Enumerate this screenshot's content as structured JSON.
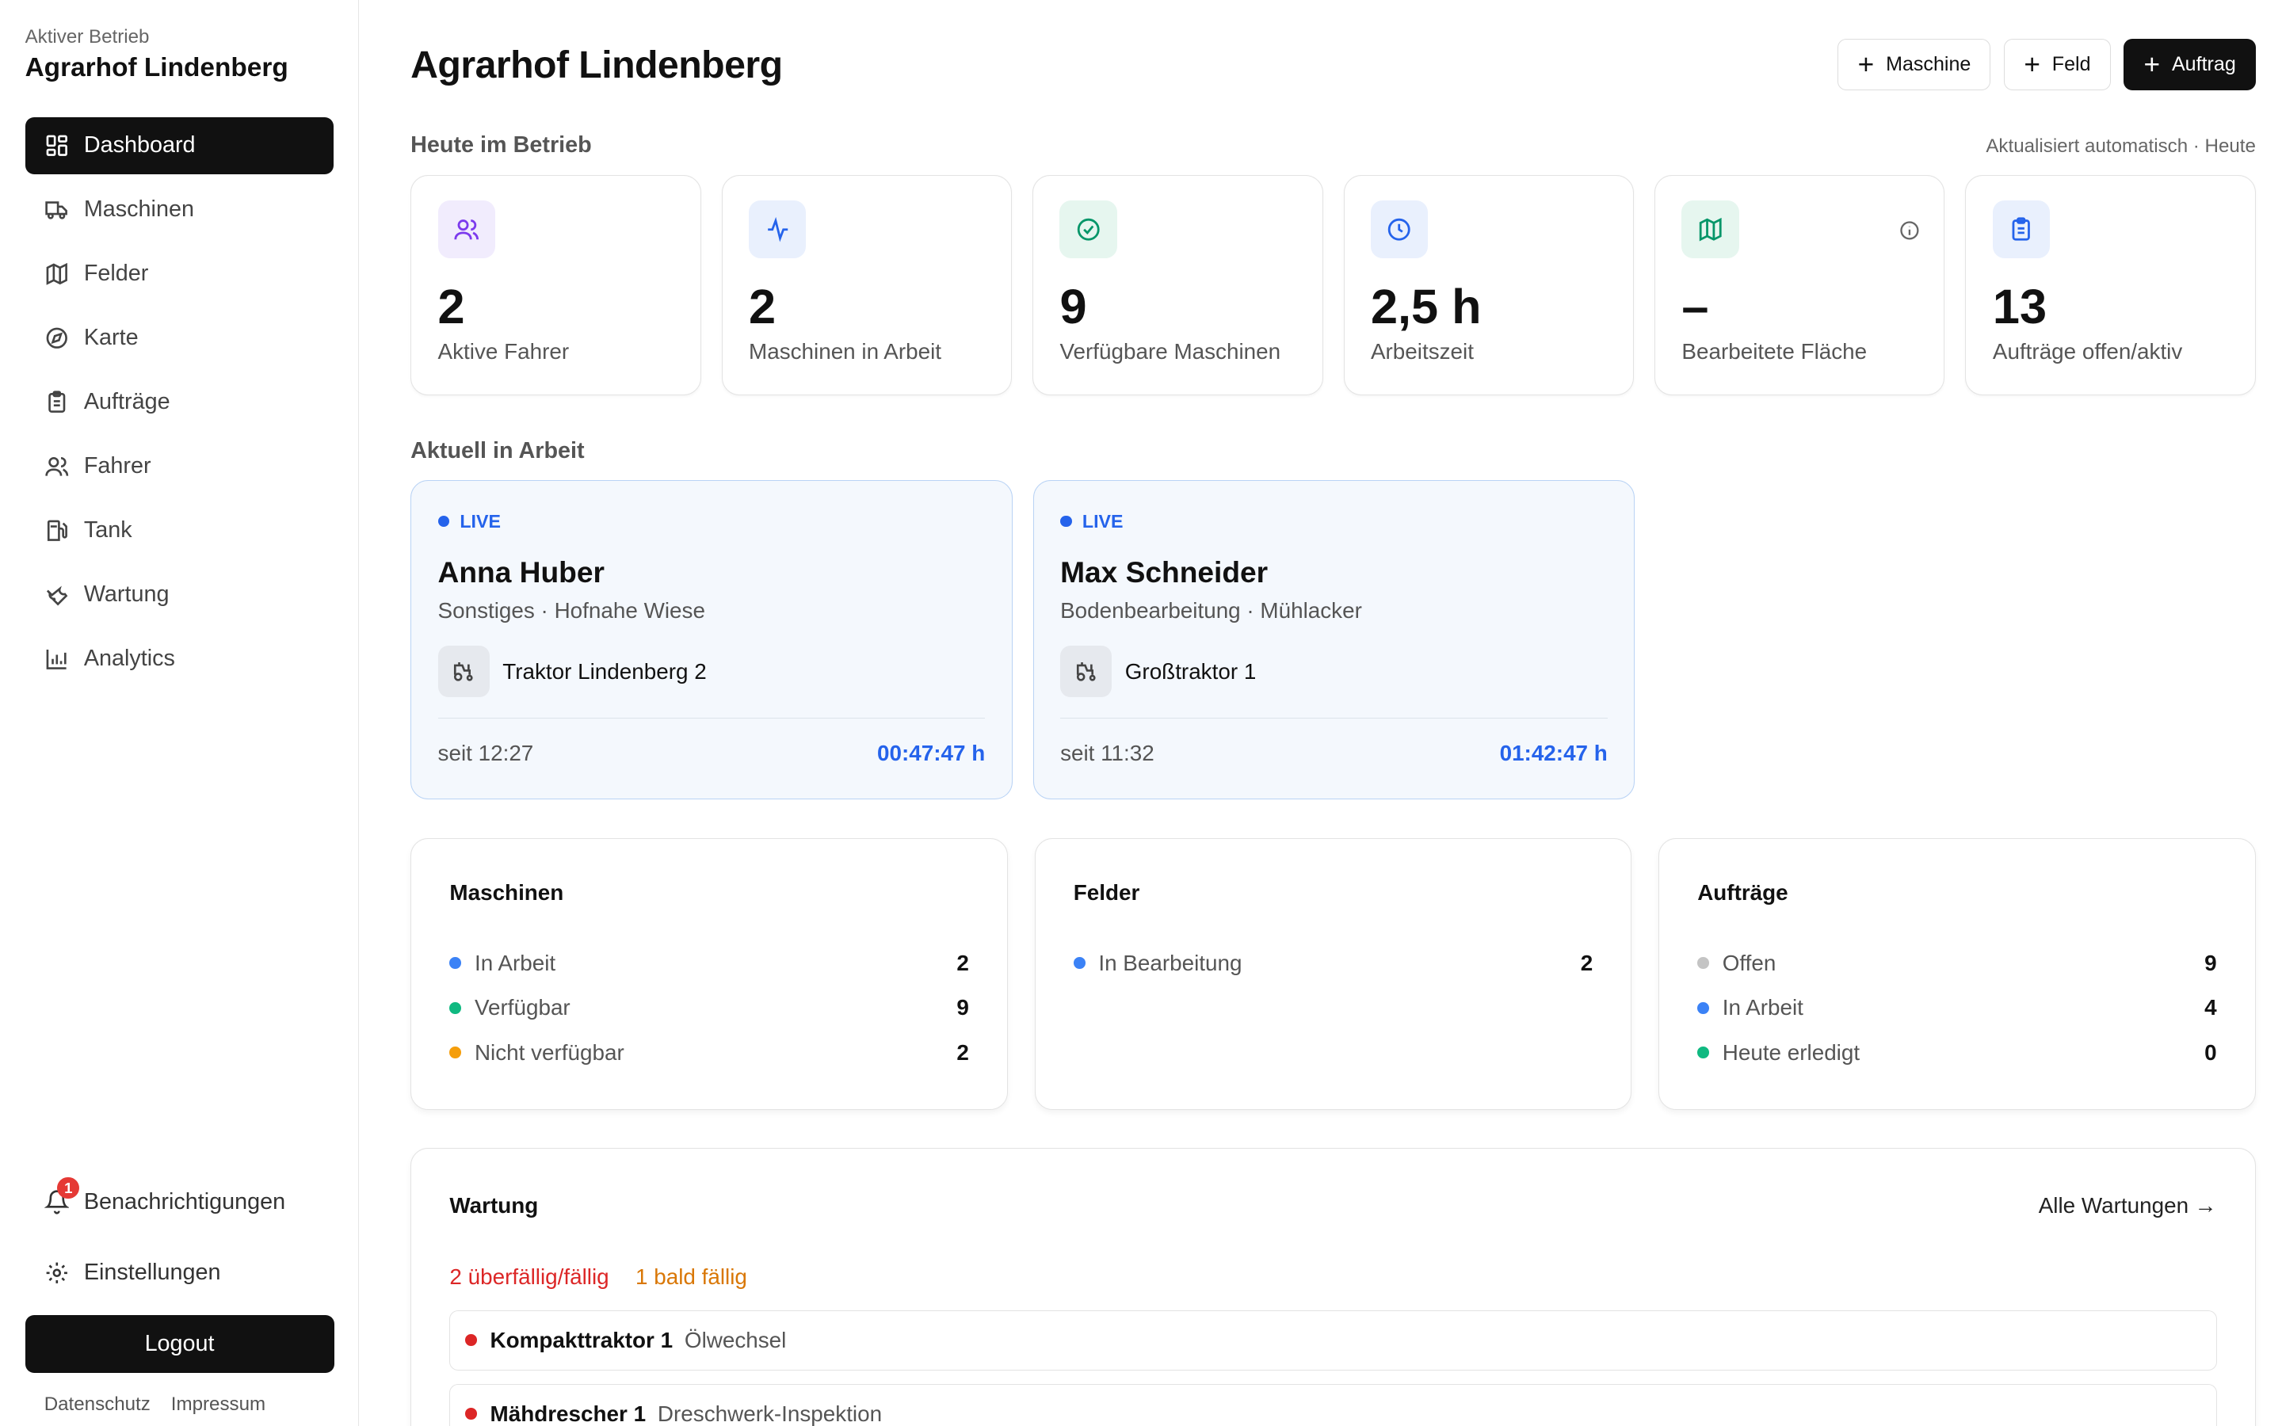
{
  "sidebar": {
    "caption": "Aktiver Betrieb",
    "farm": "Agrarhof Lindenberg",
    "items": [
      {
        "label": "Dashboard",
        "icon": "dashboard-icon"
      },
      {
        "label": "Maschinen",
        "icon": "truck-icon"
      },
      {
        "label": "Felder",
        "icon": "map-icon"
      },
      {
        "label": "Karte",
        "icon": "compass-icon"
      },
      {
        "label": "Aufträge",
        "icon": "clipboard-icon"
      },
      {
        "label": "Fahrer",
        "icon": "users-icon"
      },
      {
        "label": "Tank",
        "icon": "fuel-icon"
      },
      {
        "label": "Wartung",
        "icon": "wrench-icon"
      },
      {
        "label": "Analytics",
        "icon": "bar-chart-icon"
      }
    ],
    "notifications_label": "Benachrichtigungen",
    "notifications_count": "1",
    "settings_label": "Einstellungen",
    "logout_label": "Logout",
    "privacy_label": "Datenschutz",
    "imprint_label": "Impressum"
  },
  "header": {
    "title": "Agrarhof Lindenberg",
    "btn_machine": "Maschine",
    "btn_field": "Feld",
    "btn_order": "Auftrag"
  },
  "today": {
    "title": "Heute im Betrieb",
    "note": "Aktualisiert automatisch · Heute",
    "stats": [
      {
        "value": "2",
        "label": "Aktive Fahrer",
        "icon": "users-icon",
        "color": "#7c3aed",
        "bg": "#f1ecfd"
      },
      {
        "value": "2",
        "label": "Maschinen in Arbeit",
        "icon": "activity-icon",
        "color": "#2563eb",
        "bg": "#e9f0fd"
      },
      {
        "value": "9",
        "label": "Verfügbare Maschinen",
        "icon": "check-circle-icon",
        "color": "#059669",
        "bg": "#e6f6ef"
      },
      {
        "value": "2,5 h",
        "label": "Arbeitszeit",
        "icon": "clock-icon",
        "color": "#2563eb",
        "bg": "#e9f0fd"
      },
      {
        "value": "–",
        "label": "Bearbeitete Fläche",
        "icon": "map-icon",
        "color": "#059669",
        "bg": "#e6f6ef"
      },
      {
        "value": "13",
        "label": "Aufträge offen/aktiv",
        "icon": "clipboard-icon",
        "color": "#2563eb",
        "bg": "#e9f0fd"
      }
    ]
  },
  "work": {
    "title": "Aktuell in Arbeit",
    "jobs": [
      {
        "live": "LIVE",
        "name": "Anna Huber",
        "sub": "Sonstiges · Hofnahe Wiese",
        "machine": "Traktor Lindenberg 2",
        "since": "seit 12:27",
        "timer": "00:47:47 h"
      },
      {
        "live": "LIVE",
        "name": "Max Schneider",
        "sub": "Bodenbearbeitung · Mühlacker",
        "machine": "Großtraktor 1",
        "since": "seit 11:32",
        "timer": "01:42:47 h"
      }
    ]
  },
  "summaries": [
    {
      "title": "Maschinen",
      "rows": [
        {
          "label": "In Arbeit",
          "value": "2",
          "color": "#3b82f6"
        },
        {
          "label": "Verfügbar",
          "value": "9",
          "color": "#10b981"
        },
        {
          "label": "Nicht verfügbar",
          "value": "2",
          "color": "#f59e0b"
        }
      ]
    },
    {
      "title": "Felder",
      "rows": [
        {
          "label": "In Bearbeitung",
          "value": "2",
          "color": "#3b82f6"
        }
      ]
    },
    {
      "title": "Aufträge",
      "rows": [
        {
          "label": "Offen",
          "value": "9",
          "color": "#c4c4c4"
        },
        {
          "label": "In Arbeit",
          "value": "4",
          "color": "#3b82f6"
        },
        {
          "label": "Heute erledigt",
          "value": "0",
          "color": "#10b981"
        }
      ]
    }
  ],
  "maintenance": {
    "title": "Wartung",
    "link": "Alle Wartungen →",
    "overdue": "2 überfällig/fällig",
    "soon": "1 bald fällig",
    "items": [
      {
        "name": "Kompakttraktor 1",
        "task": "Ölwechsel"
      },
      {
        "name": "Mähdrescher 1",
        "task": "Dreschwerk-Inspektion"
      }
    ]
  }
}
